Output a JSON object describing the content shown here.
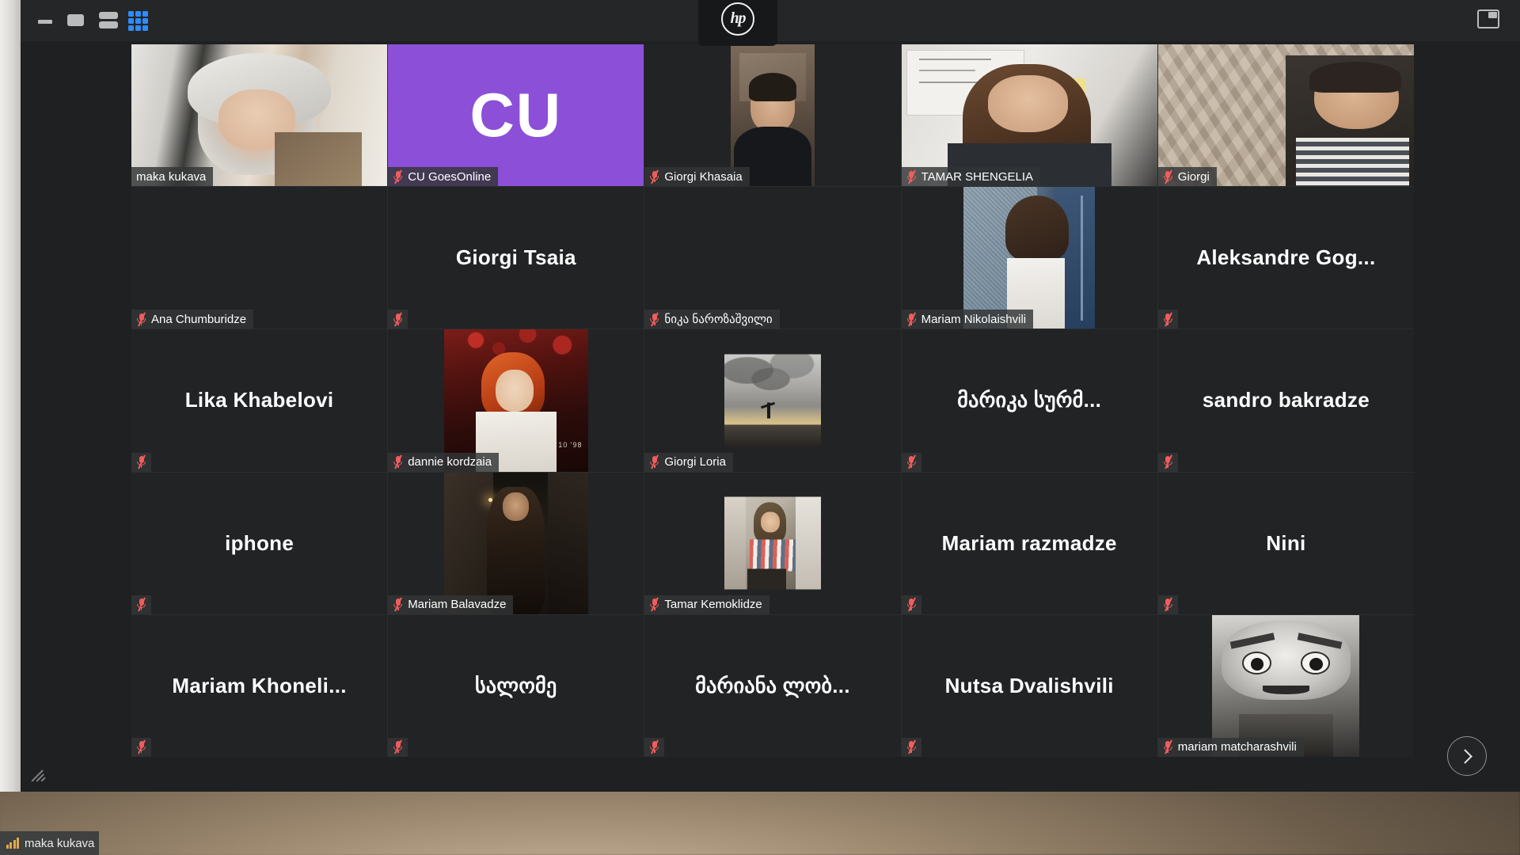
{
  "window": {
    "app": "Zoom Meeting",
    "hp_logo_text": "hp",
    "toolbar": {
      "minimize_label": "Minimize",
      "maximize_label": "Maximize",
      "speaker_view_label": "Speaker View",
      "gallery_view_label": "Gallery View",
      "window_mode_label": "Exit Full Screen",
      "active_view": "gallery",
      "accent_color": "#2d8cff"
    },
    "next_page_label": "Next page",
    "active_speaker_border_color": "#d4e157",
    "mute_icon_color": "#f05c5c"
  },
  "os_status_bar": {
    "icon": "signal-bars-icon",
    "label": "maka kukava"
  },
  "gallery": {
    "columns": 5,
    "rows": 5,
    "participants": [
      {
        "name": "maka kukava",
        "muted": false,
        "active_speaker": true,
        "label_position": "bottom-left",
        "media": "video",
        "media_style": "video-woman-room"
      },
      {
        "name": "CU GoesOnline",
        "muted": true,
        "active_speaker": false,
        "label_position": "bottom-left",
        "media": "initials",
        "initials": "CU",
        "bg_color": "#8c4fd8"
      },
      {
        "name": "Giorgi Khasaia",
        "muted": true,
        "active_speaker": false,
        "label_position": "bottom-left",
        "media": "photo",
        "media_style": "photo-man-dark-room"
      },
      {
        "name": "TAMAR SHENGELIA",
        "muted": true,
        "active_speaker": false,
        "label_position": "bottom-left",
        "media": "video",
        "media_style": "video-woman-whiteboard"
      },
      {
        "name": "Giorgi",
        "muted": true,
        "active_speaker": false,
        "label_position": "bottom-left",
        "media": "video",
        "media_style": "video-man-wallpaper"
      },
      {
        "name": "Ana Chumburidze",
        "muted": true,
        "active_speaker": false,
        "label_position": "bottom-left",
        "media": "none"
      },
      {
        "name": "Giorgi Tsaia",
        "muted": true,
        "active_speaker": false,
        "label_position": "center-name",
        "media": "none"
      },
      {
        "name": "ნიკა ნაროზაშვილი",
        "muted": true,
        "active_speaker": false,
        "label_position": "bottom-left",
        "media": "none"
      },
      {
        "name": "Mariam Nikolaishvili",
        "muted": true,
        "active_speaker": false,
        "label_position": "bottom-left",
        "media": "photo",
        "media_style": "photo-woman-blue-door"
      },
      {
        "name": "Aleksandre  Gog...",
        "muted": true,
        "active_speaker": false,
        "label_position": "center-name",
        "media": "none"
      },
      {
        "name": "Lika Khabelovi",
        "muted": true,
        "active_speaker": false,
        "label_position": "center-name",
        "media": "none"
      },
      {
        "name": "dannie kordzaia",
        "muted": true,
        "active_speaker": false,
        "label_position": "bottom-left",
        "media": "photo",
        "media_style": "photo-redhead-red"
      },
      {
        "name": "Giorgi Loria",
        "muted": true,
        "active_speaker": false,
        "label_position": "bottom-left",
        "media": "photo",
        "media_style": "photo-bw-sky"
      },
      {
        "name": "მარიკა სურმ...",
        "muted": true,
        "active_speaker": false,
        "label_position": "center-name",
        "media": "none"
      },
      {
        "name": "sandro bakradze",
        "muted": true,
        "active_speaker": false,
        "label_position": "center-name",
        "media": "none"
      },
      {
        "name": "iphone",
        "muted": true,
        "active_speaker": false,
        "label_position": "center-name",
        "media": "none"
      },
      {
        "name": "Mariam Balavadze",
        "muted": true,
        "active_speaker": false,
        "label_position": "bottom-left",
        "media": "photo",
        "media_style": "photo-night-street"
      },
      {
        "name": "Tamar Kemoklidze",
        "muted": true,
        "active_speaker": false,
        "label_position": "bottom-left",
        "media": "photo",
        "media_style": "photo-girl-mirror"
      },
      {
        "name": "Mariam razmadze",
        "muted": true,
        "active_speaker": false,
        "label_position": "center-name",
        "media": "none"
      },
      {
        "name": "Nini",
        "muted": true,
        "active_speaker": false,
        "label_position": "center-name",
        "media": "none"
      },
      {
        "name": "Mariam  Khoneli...",
        "muted": true,
        "active_speaker": false,
        "label_position": "center-name",
        "media": "none"
      },
      {
        "name": "სალომე",
        "muted": true,
        "active_speaker": false,
        "label_position": "center-name",
        "media": "none"
      },
      {
        "name": "მარიანა ლობ...",
        "muted": true,
        "active_speaker": false,
        "label_position": "center-name",
        "media": "none"
      },
      {
        "name": "Nutsa Dvalishvili",
        "muted": true,
        "active_speaker": false,
        "label_position": "center-name",
        "media": "none"
      },
      {
        "name": "mariam matcharashvili",
        "muted": true,
        "active_speaker": false,
        "label_position": "bottom-left",
        "media": "photo",
        "media_style": "photo-dali-bw"
      }
    ]
  }
}
